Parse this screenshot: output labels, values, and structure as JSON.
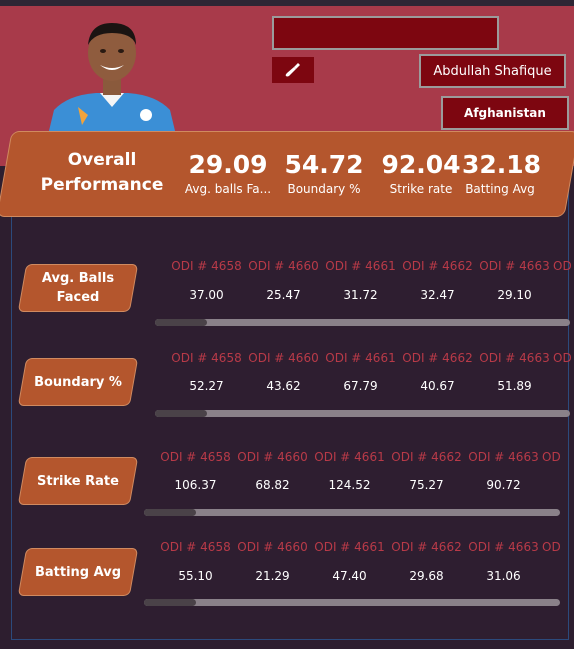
{
  "header": {
    "player_name": "Abdullah Shafique",
    "team": "Afghanistan",
    "search_value": ""
  },
  "overall": {
    "title_line1": "Overall",
    "title_line2": "Performance",
    "kpis": [
      {
        "value": "29.09",
        "label": "Avg. balls Fa..."
      },
      {
        "value": "54.72",
        "label": "Boundary %"
      },
      {
        "value": "92.04",
        "label": "Strike rate"
      },
      {
        "value": "32.18",
        "label": "Batting Avg"
      }
    ]
  },
  "sections": [
    {
      "label_line1": "Avg. Balls",
      "label_line2": "Faced",
      "matches": [
        "ODI # 4658",
        "ODI # 4660",
        "ODI # 4661",
        "ODI # 4662",
        "ODI # 4663",
        "OD"
      ],
      "values": [
        "37.00",
        "25.47",
        "31.72",
        "32.47",
        "29.10"
      ]
    },
    {
      "label_line1": "Boundary %",
      "label_line2": "",
      "matches": [
        "ODI # 4658",
        "ODI # 4660",
        "ODI # 4661",
        "ODI # 4662",
        "ODI # 4663",
        "OD"
      ],
      "values": [
        "52.27",
        "43.62",
        "67.79",
        "40.67",
        "51.89"
      ]
    },
    {
      "label_line1": "Strike Rate",
      "label_line2": "",
      "matches": [
        "ODI # 4658",
        "ODI # 4660",
        "ODI # 4661",
        "ODI # 4662",
        "ODI # 4663",
        "OD"
      ],
      "values": [
        "106.37",
        "68.82",
        "124.52",
        "75.27",
        "90.72"
      ]
    },
    {
      "label_line1": "Batting Avg",
      "label_line2": "",
      "matches": [
        "ODI # 4658",
        "ODI # 4660",
        "ODI # 4661",
        "ODI # 4662",
        "ODI # 4663",
        "OD"
      ],
      "values": [
        "55.10",
        "21.29",
        "47.40",
        "29.68",
        "31.06"
      ]
    }
  ],
  "icons": {
    "bat": "cricket-bat-icon"
  },
  "colors": {
    "header_bg": "#a83a4a",
    "accent": "#b4562d",
    "dark_red": "#7d0610",
    "panel_bg": "#2e1e30",
    "match_label": "#b83a48"
  }
}
